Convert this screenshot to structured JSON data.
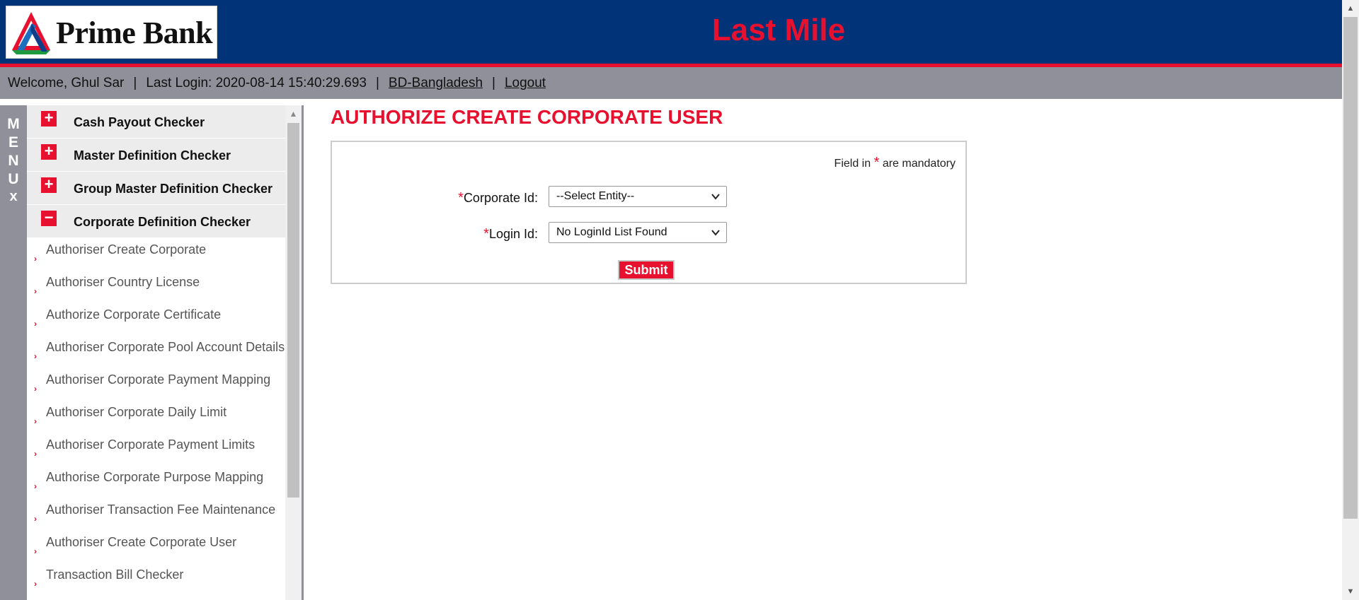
{
  "header": {
    "logo_text": "Prime Bank",
    "app_title": "Last Mile"
  },
  "infobar": {
    "welcome": "Welcome, Ghul Sar",
    "separator": "|",
    "last_login": "Last Login: 2020-08-14 15:40:29.693",
    "country_link": "BD-Bangladesh",
    "logout_link": "Logout"
  },
  "menu": {
    "letters": [
      "M",
      "E",
      "N",
      "U"
    ],
    "close_glyph": "x"
  },
  "sidebar": {
    "categories": [
      {
        "label": "Cash Payout Checker",
        "icon": "plus-icon",
        "glyph": "+"
      },
      {
        "label": "Master Definition Checker",
        "icon": "plus-icon",
        "glyph": "+"
      },
      {
        "label": "Group Master Definition Checker",
        "icon": "plus-icon",
        "glyph": "+"
      },
      {
        "label": "Corporate Definition Checker",
        "icon": "minus-icon",
        "glyph": "−"
      }
    ],
    "bullet_glyph": "›",
    "items": [
      {
        "label": "Authoriser Create Corporate"
      },
      {
        "label": "Authoriser Country License"
      },
      {
        "label": "Authorize Corporate Certificate"
      },
      {
        "label": "Authoriser Corporate Pool Account Details"
      },
      {
        "label": "Authoriser Corporate Payment Mapping"
      },
      {
        "label": "Authoriser Corporate Daily Limit"
      },
      {
        "label": "Authoriser Corporate Payment Limits"
      },
      {
        "label": "Authorise Corporate Purpose Mapping"
      },
      {
        "label": "Authoriser Transaction Fee Maintenance"
      },
      {
        "label": "Authoriser Create Corporate User"
      },
      {
        "label": "Transaction Bill Checker"
      }
    ]
  },
  "main": {
    "page_title": "AUTHORIZE CREATE CORPORATE USER",
    "form": {
      "mandatory_prefix": "Field in",
      "mandatory_star": "*",
      "mandatory_suffix": "are mandatory",
      "fields": [
        {
          "star": "*",
          "label": "Corporate Id:",
          "value": "--Select Entity--"
        },
        {
          "star": "*",
          "label": "Login Id:",
          "value": "No LoginId List Found"
        }
      ],
      "submit_label": "Submit"
    }
  },
  "colors": {
    "header_bg": "#003377",
    "accent_red": "#e8102f",
    "bar_gray": "#8f9099",
    "category_bg": "#ececec"
  }
}
